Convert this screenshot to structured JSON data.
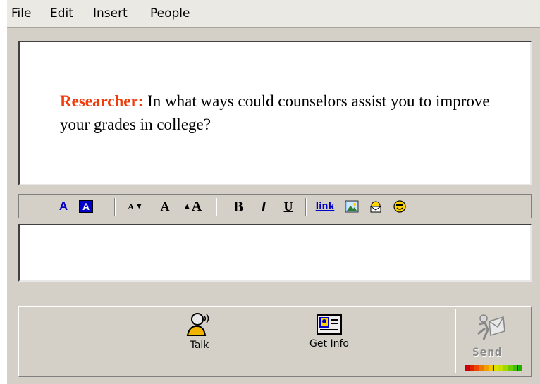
{
  "menu": {
    "items": [
      "File",
      "Edit",
      "Insert",
      "People"
    ]
  },
  "conversation": {
    "speaker": "Researcher:",
    "text": " In what ways could counselors assist you to improve your grades in college?"
  },
  "format_toolbar": {
    "text_color_label": "A",
    "highlight_label": "A",
    "smaller_font_label": "A",
    "normal_font_label": "A",
    "larger_font_label": "A",
    "bold_label": "B",
    "italic_label": "I",
    "underline_label": "U",
    "link_label": "link"
  },
  "input": {
    "value": ""
  },
  "buttons": {
    "talk": "Talk",
    "get_info": "Get Info",
    "send": "Send"
  },
  "colors": {
    "speaker": "#f03c0c",
    "toolbar_blue": "#0000c8",
    "send_disabled": "#8a8a8a"
  },
  "icons": {
    "talk": "talk-person-icon",
    "get_info": "id-card-icon",
    "send": "send-envelope-icon",
    "insert_image": "image-icon",
    "email": "email-icon",
    "emoticon": "smiley-icon"
  }
}
